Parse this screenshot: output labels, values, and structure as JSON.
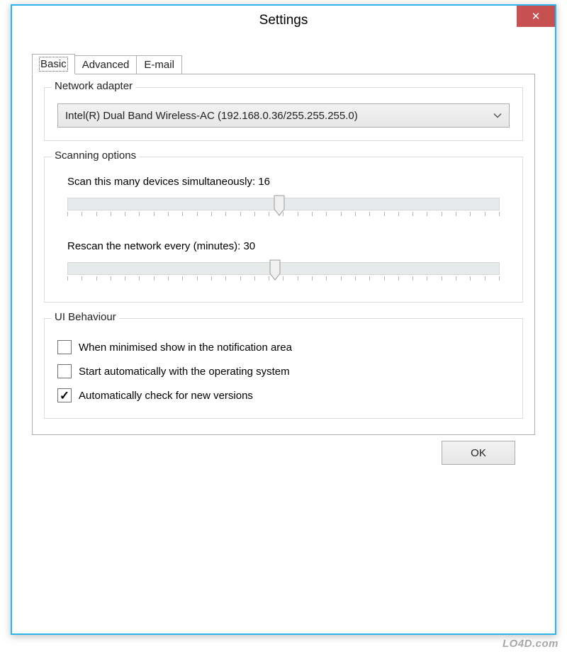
{
  "window": {
    "title": "Settings",
    "close_symbol": "✕"
  },
  "tabs": {
    "basic": "Basic",
    "advanced": "Advanced",
    "email": "E-mail"
  },
  "network_adapter": {
    "group_label": "Network adapter",
    "selected": "Intel(R) Dual Band Wireless-AC (192.168.0.36/255.255.255.0)"
  },
  "scanning": {
    "group_label": "Scanning options",
    "sim_label_prefix": "Scan this many devices simultaneously: ",
    "sim_value": "16",
    "sim_thumb_percent": 49,
    "rescan_label_prefix": "Rescan the network every (minutes): ",
    "rescan_value": "30",
    "rescan_thumb_percent": 48
  },
  "ui_behaviour": {
    "group_label": "UI Behaviour",
    "minimise_label": "When minimised show in the notification area",
    "minimise_checked": false,
    "autostart_label": "Start automatically with the operating system",
    "autostart_checked": false,
    "autoupdate_label": "Automatically check for new versions",
    "autoupdate_checked": true
  },
  "buttons": {
    "ok": "OK"
  },
  "watermark": "LO4D.com"
}
